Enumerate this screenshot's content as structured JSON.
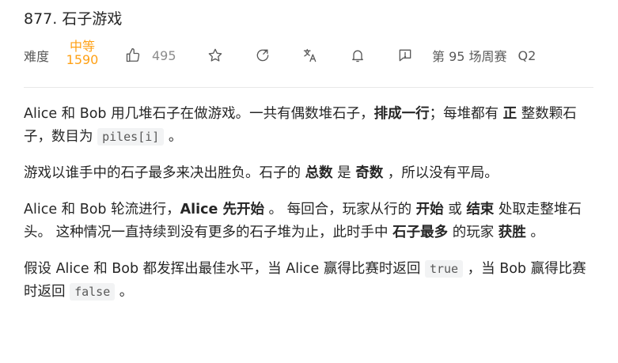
{
  "problem": {
    "title": "877. 石子游戏"
  },
  "meta": {
    "difficulty_label": "难度",
    "difficulty_value": "中等",
    "rating": "1590",
    "likes": "495",
    "contest_label": "第 95 场周赛",
    "contest_question": "Q2"
  },
  "icons": {
    "like": "thumbs-up-icon",
    "star": "star-icon",
    "share": "share-icon",
    "translate": "translate-icon",
    "bell": "bell-icon",
    "feedback": "feedback-icon"
  },
  "colors": {
    "difficulty": "#ffa116",
    "text": "#262626",
    "muted": "#8c8c8c"
  },
  "description": {
    "p1": {
      "a": "Alice 和 Bob 用几堆石子在做游戏。一共有偶数堆石子，",
      "b1": "排成一行",
      "c": "；每堆都有 ",
      "b2": "正",
      "d": " 整数颗石子，数目为 ",
      "code": "piles[i]",
      "e": " 。"
    },
    "p2": {
      "a": "游戏以谁手中的石子最多来决出胜负。石子的 ",
      "b1": "总数",
      "c": " 是 ",
      "b2": "奇数",
      "d": " ，所以没有平局。"
    },
    "p3": {
      "a": "Alice 和 Bob 轮流进行，",
      "b1": "Alice 先开始",
      "c": " 。 每回合，玩家从行的 ",
      "b2": "开始",
      "d": " 或 ",
      "b3": "结束",
      "e": " 处取走整堆石头。 这种情况一直持续到没有更多的石子堆为止，此时手中 ",
      "b4": "石子最多",
      "f": " 的玩家 ",
      "b5": "获胜",
      "g": " 。"
    },
    "p4": {
      "a": "假设 Alice 和 Bob 都发挥出最佳水平，当 Alice 赢得比赛时返回 ",
      "code1": "true",
      "b": " ，当 Bob 赢得比赛时返回 ",
      "code2": "false",
      "c": " 。"
    }
  }
}
